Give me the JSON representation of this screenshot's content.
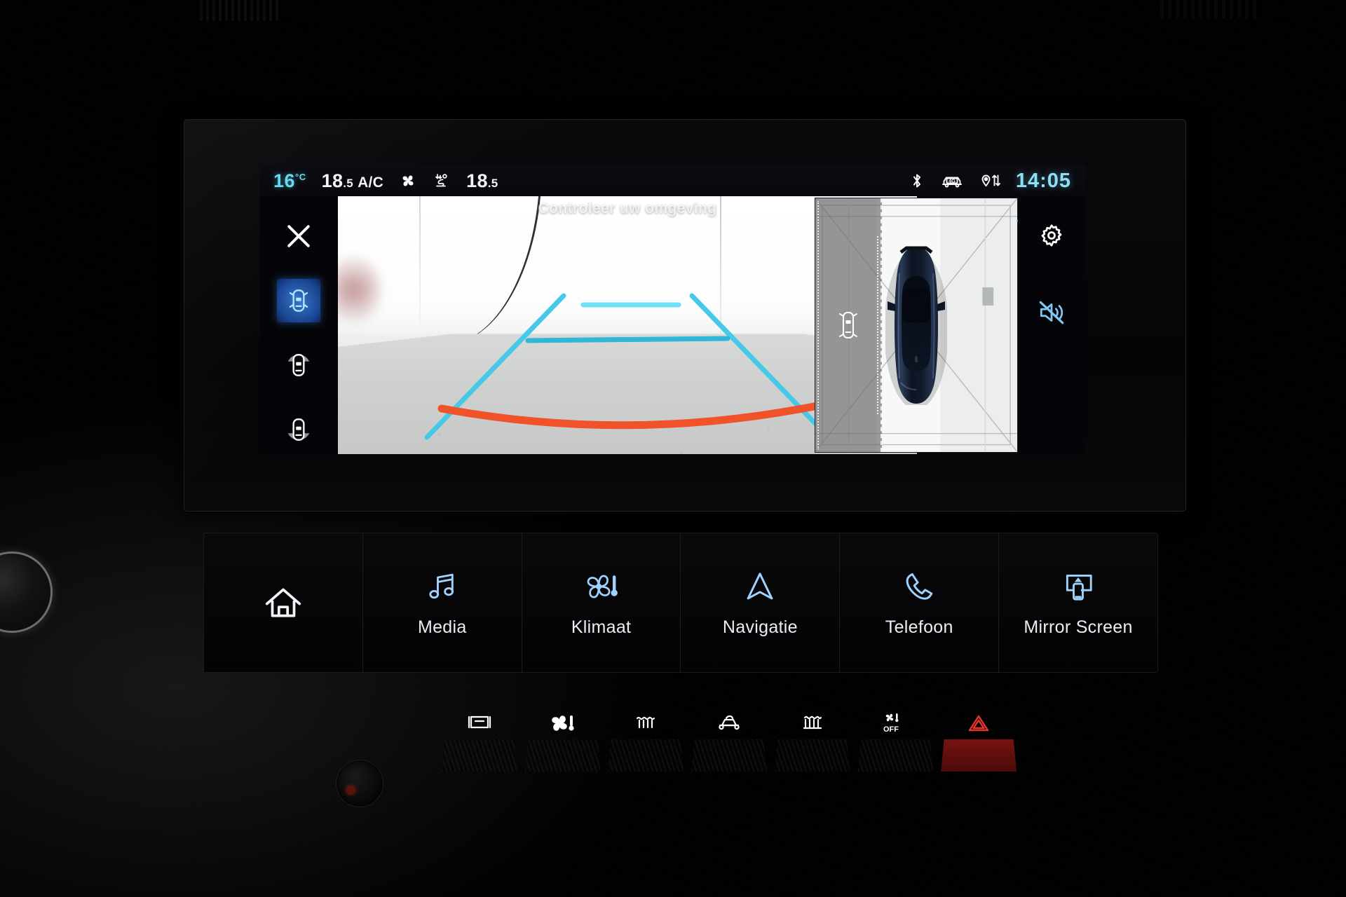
{
  "status_bar": {
    "outside_temp": "16",
    "outside_temp_unit": "°C",
    "driver_temp_int": "18",
    "driver_temp_dec": ".5",
    "ac_label": "A/C",
    "passenger_temp_int": "18",
    "passenger_temp_dec": ".5",
    "fan_icon": "fan-icon",
    "airflow_icon": "airflow-seat-icon",
    "bluetooth_icon": "bluetooth-icon",
    "connectivity_icon": "car-4g-icon",
    "connectivity_label": "4G",
    "gps_icon": "gps-pin-transfer-icon",
    "clock": "14:05"
  },
  "camera_view": {
    "hint_text": "Controleer uw omgeving",
    "guideline_color_near": "#F0522A",
    "guideline_color_far": "#4ED9F2",
    "view_mode": "rear-360"
  },
  "left_rail": {
    "close_label": "close-icon",
    "items": [
      {
        "name": "view-360-surround",
        "icon": "car-360-icon",
        "active": true
      },
      {
        "name": "view-front",
        "icon": "car-front-sensor-icon",
        "active": false
      },
      {
        "name": "view-rear",
        "icon": "car-rear-sensor-icon",
        "active": false
      }
    ]
  },
  "right_rail": {
    "collapse_icon": "chevron-left-icon",
    "items": [
      {
        "name": "camera-settings",
        "icon": "gear-icon"
      },
      {
        "name": "mute-parking-sound",
        "icon": "speaker-muted-icon",
        "muted": true
      }
    ]
  },
  "birdseye": {
    "zone_icon": "car-side-alert-icon",
    "vehicle_color": "#0d1526",
    "alert_zone_side": "left"
  },
  "touch_bar": {
    "items": [
      {
        "label": "",
        "name": "home-button",
        "icon": "home-icon"
      },
      {
        "label": "Media",
        "name": "media-button",
        "icon": "music-note-icon"
      },
      {
        "label": "Klimaat",
        "name": "climate-button",
        "icon": "fan-thermometer-icon"
      },
      {
        "label": "Navigatie",
        "name": "navigation-button",
        "icon": "navigation-arrow-icon"
      },
      {
        "label": "Telefoon",
        "name": "phone-button",
        "icon": "phone-handset-icon"
      },
      {
        "label": "Mirror Screen",
        "name": "mirror-screen-button",
        "icon": "screen-mirroring-icon"
      }
    ]
  },
  "physical_buttons": [
    {
      "name": "windshield-defrost-button",
      "icon": "windshield-defrost-icon"
    },
    {
      "name": "climate-menu-button",
      "icon": "fan-thermometer-icon"
    },
    {
      "name": "front-windshield-heat-button",
      "icon": "windshield-heat-icon"
    },
    {
      "name": "air-recirculation-button",
      "icon": "recirculation-icon"
    },
    {
      "name": "rear-defrost-button",
      "icon": "rear-defrost-icon"
    },
    {
      "name": "climate-off-button",
      "icon": "climate-off-icon",
      "label": "OFF"
    },
    {
      "name": "hazard-lights-button",
      "icon": "hazard-triangle-icon",
      "color": "#E8352B"
    }
  ],
  "colors": {
    "accent_cyan": "#7FE3FF",
    "accent_blue": "#9FD2FF",
    "warning_orange": "#F0522A",
    "hazard_red": "#E8352B",
    "screen_bg": "#07070A"
  }
}
